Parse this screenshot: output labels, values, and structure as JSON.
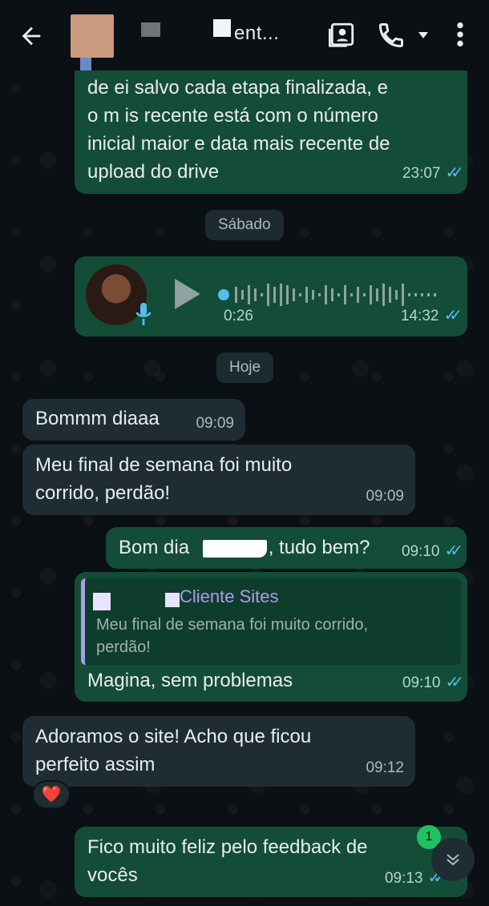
{
  "header": {
    "contact_name": "ent..."
  },
  "messages": [
    {
      "id": "m1",
      "text_line1": "de   ei salvo cada etapa finalizada, e",
      "text_line2": "o m  is recente está com o número",
      "text_line3": "inicial maior e data mais recente de",
      "text_line4": "upload do drive",
      "time": "23:07"
    },
    {
      "id": "day1",
      "label": "Sábado"
    },
    {
      "id": "voice",
      "duration": "0:26",
      "time": "14:32"
    },
    {
      "id": "day2",
      "label": "Hoje"
    },
    {
      "id": "m2",
      "text": "Bommm diaaa",
      "time": "09:09"
    },
    {
      "id": "m3",
      "text_line1": "Meu final de semana foi muito",
      "text_line2": "corrido, perdão!",
      "time": "09:09"
    },
    {
      "id": "m4",
      "text_before": "Bom dia",
      "text_after": ", tudo bem?",
      "time": "09:10"
    },
    {
      "id": "m5",
      "quote_author": "Cliente Sites",
      "quote_line1": "Meu final de semana foi muito corrido,",
      "quote_line2": "perdão!",
      "text": "Magina, sem problemas",
      "time": "09:10"
    },
    {
      "id": "m6",
      "text_line1": "Adoramos o site! Acho que ficou",
      "text_line2": "perfeito assim",
      "time": "09:12",
      "reaction": "❤️"
    },
    {
      "id": "m7",
      "text_line1": "Fico muito feliz pelo feedback de",
      "text_line2": "vocês",
      "time": "09:13"
    }
  ],
  "unread_count": "1",
  "colors": {
    "outgoing_bubble": "#134d37",
    "incoming_bubble": "#202c33",
    "read_ticks": "#53bdeb",
    "unread_badge": "#21c063"
  }
}
